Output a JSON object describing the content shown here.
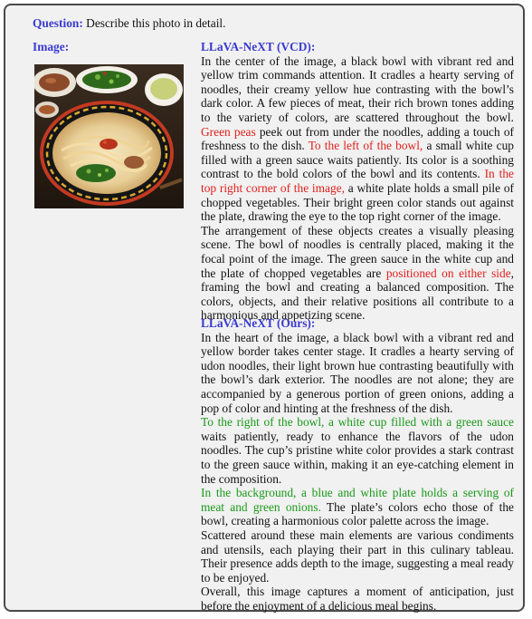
{
  "question": {
    "label": "Question:",
    "text": " Describe this photo in detail."
  },
  "image_label": "Image:",
  "vcd": {
    "title": "LLaVA-NeXT (VCD):",
    "p1": [
      {
        "t": "In the center of the image, a black bowl with vibrant red and yellow trim commands attention. It cradles a hearty serving of noodles, their creamy yellow hue contrasting with the bowl’s dark color. A few pieces of meat, their rich brown tones adding to the variety of colors, are scattered throughout the bowl. ",
        "c": ""
      },
      {
        "t": "Green peas",
        "c": "red"
      },
      {
        "t": " peek out from under the noodles, adding a touch of freshness to the dish. ",
        "c": ""
      },
      {
        "t": "To the left of the bowl,",
        "c": "red"
      },
      {
        "t": " a small white cup filled with a green sauce waits patiently. Its color is a soothing contrast to the bold colors of the bowl and its contents. ",
        "c": ""
      },
      {
        "t": "In the top right corner of the image,",
        "c": "red"
      },
      {
        "t": " a white plate holds a small pile of chopped vegetables. Their bright green color stands out against the plate, drawing the eye to the top right corner of the image.",
        "c": ""
      }
    ],
    "p2": [
      {
        "t": "The arrangement of these objects creates a visually pleasing scene. The bowl of noodles is centrally placed, making it the focal point of the image. The green sauce in the white cup and the plate of chopped vegetables are ",
        "c": ""
      },
      {
        "t": "positioned on either side",
        "c": "red"
      },
      {
        "t": ", framing the bowl and creating a balanced composition. The colors, objects, and their relative positions all contribute to a harmonious and appetizing scene.",
        "c": ""
      }
    ]
  },
  "ours": {
    "title": "LLaVA-NeXT (Ours):",
    "p1": [
      {
        "t": "In the heart of the image, a black bowl with a vibrant red and yellow border takes center stage. It cradles a hearty serving of udon noodles, their light brown hue contrasting beautifully with the bowl’s dark exterior. The noodles are not alone; they are accompanied by a generous portion of green onions, adding a pop of color and hinting at the freshness of the dish.",
        "c": ""
      }
    ],
    "p2": [
      {
        "t": "To the right of the bowl, a white cup filled with a green sauce",
        "c": "green"
      },
      {
        "t": " waits patiently, ready to enhance the flavors of the udon noodles. The cup’s pristine white color provides a stark contrast to the green sauce within, making it an eye-catching element in the composition.",
        "c": ""
      }
    ],
    "p3": [
      {
        "t": "In the background, a blue and white plate holds a serving of meat and green onions.",
        "c": "green"
      },
      {
        "t": " The plate’s colors echo those of the bowl, creating a harmonious color palette across the image.",
        "c": ""
      }
    ],
    "p4": [
      {
        "t": "Scattered around these main elements are various condiments and utensils, each playing their part in this culinary tableau. Their presence adds depth to the image, suggesting a meal ready to be enjoyed.",
        "c": ""
      }
    ],
    "p5": [
      {
        "t": "Overall, this image captures a moment of anticipation, just before the enjoyment of a delicious meal begins.",
        "c": ""
      }
    ]
  }
}
